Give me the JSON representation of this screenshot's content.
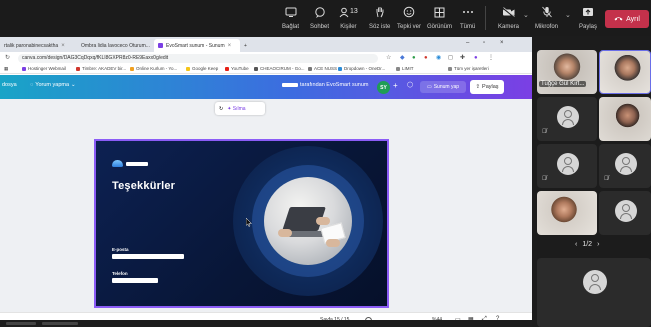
{
  "teams_toolbar": {
    "buttons": [
      {
        "label": "Bağlat",
        "icon": "phone-icon"
      },
      {
        "label": "Sohbet",
        "icon": "chat-icon"
      },
      {
        "label": "Kişiler",
        "icon": "people-icon",
        "count": "13"
      },
      {
        "label": "Söz iste",
        "icon": "raise-hand-icon"
      },
      {
        "label": "Tepki ver",
        "icon": "emoji-icon"
      },
      {
        "label": "Görünüm",
        "icon": "grid-icon"
      },
      {
        "label": "Tümü",
        "icon": "more-icon"
      },
      {
        "label": "Kamera",
        "icon": "camera-off-icon"
      },
      {
        "label": "Mikrofon",
        "icon": "mic-off-icon"
      },
      {
        "label": "Paylaş",
        "icon": "share-screen-icon"
      }
    ],
    "leave_label": "Ayrıl",
    "leave_color": "#c4314b"
  },
  "browser": {
    "tabs": [
      {
        "title": "rtalik paronabinecsaktha"
      },
      {
        "title": "Ombra lidia lavoceco Oturum..."
      },
      {
        "title": "EvoSmart sunum - Sunum"
      }
    ],
    "address": "canva.com/design/DAG3CqDqxq/fKLI8GXPR8z0-RE9Eaxx0g/edit",
    "bookmarks": [
      "Hostinger Webmail",
      "Timbre: AKADEV bir...",
      "Online Kurlum - Yo...",
      "Google Keep",
      "YouTube",
      "CHEAOCIRUM - Go...",
      "ACE NUSS",
      "Dropdown - OneDr...",
      "LIMIT",
      "Tüm yer işaretleri"
    ]
  },
  "canva": {
    "left_label": "dosya",
    "comment_label": "Yorum yapma",
    "owner_text": "tarafından EvoSmart sunum",
    "avatar_initials": "SY",
    "present_label": "Sunum yap",
    "share_label": "Paylaş",
    "ai_label": "Sılma",
    "accent": "#8b5cf6"
  },
  "slide": {
    "title": "Teşekkürler",
    "email_label": "E-posta",
    "phone_label": "Telefon"
  },
  "status": {
    "page_text": "Sayfa 15 / 15",
    "zoom_text": "%44",
    "zoom_level": 0.44
  },
  "participants": [
    {
      "name": "Tuğçe Gül Kırt...",
      "type": "video"
    },
    {
      "name": "",
      "type": "video"
    },
    {
      "name": "",
      "type": "avatar"
    },
    {
      "name": "",
      "type": "video"
    },
    {
      "name": "",
      "type": "avatar"
    },
    {
      "name": "",
      "type": "avatar"
    },
    {
      "name": "",
      "type": "video"
    },
    {
      "name": "",
      "type": "avatar"
    },
    {
      "name": "",
      "type": "avatar"
    }
  ],
  "pager": {
    "text": "1/2"
  }
}
